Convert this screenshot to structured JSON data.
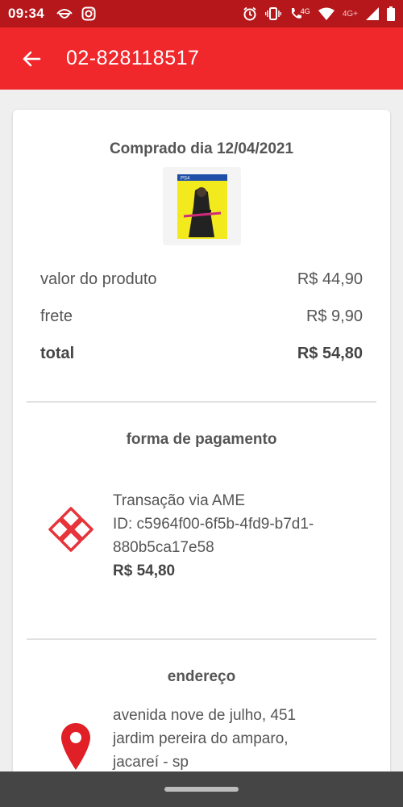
{
  "status_bar": {
    "time": "09:34",
    "network": "4G",
    "network_plus": "4G+",
    "colors": {
      "background": "#b5171b"
    }
  },
  "app_bar": {
    "title": "02-828118517",
    "back_icon": "arrow-left-icon",
    "colors": {
      "background": "#f0272b"
    }
  },
  "order": {
    "purchased_label": "Comprado dia 12/04/2021",
    "product_image": "cyberpunk-ps4-cover"
  },
  "prices": {
    "product_label": "valor do produto",
    "product_value": "R$ 44,90",
    "shipping_label": "frete",
    "shipping_value": "R$ 9,90",
    "total_label": "total",
    "total_value": "R$ 54,80"
  },
  "payment": {
    "title": "forma de pagamento",
    "method": "Transação via AME",
    "transaction_id": "ID: c5964f00-6f5b-4fd9-b7d1-880b5ca17e58",
    "amount": "R$ 54,80",
    "icon": "ame-logo-icon",
    "colors": {
      "icon": "#e6343a"
    }
  },
  "address": {
    "title": "endereço",
    "line1": "avenida nove de julho, 451",
    "line2": "jardim pereira do amparo,",
    "line3": "jacareí - sp",
    "icon": "location-pin-icon",
    "colors": {
      "icon": "#e01f26"
    }
  }
}
